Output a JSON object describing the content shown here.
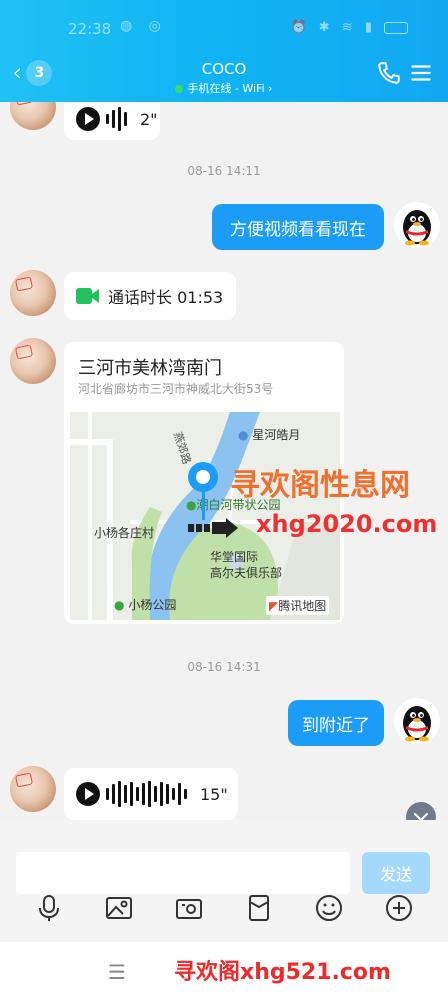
{
  "status_bar": {
    "time": "22:38"
  },
  "header": {
    "unread_count": "3",
    "contact_name": "COCO",
    "contact_status": "手机在线 - WiFi ›"
  },
  "messages": {
    "voice1_duration": "2\"",
    "time1": "08-16 14:11",
    "text1": "方便视频看看现在",
    "call_label": "通话时长 01:53",
    "location_title": "三河市美林湾南门",
    "location_address": "河北省廊坊市三河市神威北大街53号",
    "map_labels": {
      "road": "燕郊路",
      "poi1": "星河皓月",
      "poi2": "潮白河带状公园",
      "poi3": "小杨各庄村",
      "poi4": "华堂国际",
      "poi5": "高尔夫俱乐部",
      "poi6": "小杨公园",
      "brand": "腾讯地图"
    },
    "time2": "08-16 14:31",
    "text2": "到附近了",
    "voice2_duration": "15\""
  },
  "watermarks": {
    "line1": "寻欢阁性息网",
    "line2": "xhg2020.com",
    "line3": "寻欢阁xhg521.com"
  },
  "input": {
    "placeholder": "",
    "send_label": "发送"
  },
  "icons": [
    "mic-icon",
    "image-icon",
    "camera-icon",
    "red-packet-icon",
    "emoji-icon",
    "plus-icon"
  ]
}
